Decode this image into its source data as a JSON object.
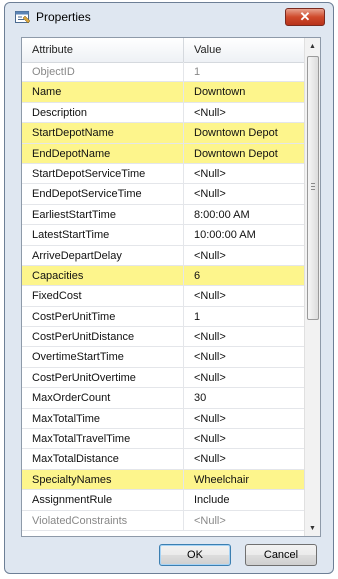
{
  "window": {
    "title": "Properties",
    "close_label": "✕"
  },
  "columns": {
    "attribute": "Attribute",
    "value": "Value"
  },
  "rows": [
    {
      "attribute": "ObjectID",
      "value": "1",
      "highlight": false,
      "grey": true
    },
    {
      "attribute": "Name",
      "value": "Downtown",
      "highlight": true,
      "grey": false
    },
    {
      "attribute": "Description",
      "value": "<Null>",
      "highlight": false,
      "grey": false
    },
    {
      "attribute": "StartDepotName",
      "value": "Downtown Depot",
      "highlight": true,
      "grey": false
    },
    {
      "attribute": "EndDepotName",
      "value": "Downtown Depot",
      "highlight": true,
      "grey": false
    },
    {
      "attribute": "StartDepotServiceTime",
      "value": "<Null>",
      "highlight": false,
      "grey": false
    },
    {
      "attribute": "EndDepotServiceTime",
      "value": "<Null>",
      "highlight": false,
      "grey": false
    },
    {
      "attribute": "EarliestStartTime",
      "value": "8:00:00 AM",
      "highlight": false,
      "grey": false
    },
    {
      "attribute": "LatestStartTime",
      "value": "10:00:00 AM",
      "highlight": false,
      "grey": false
    },
    {
      "attribute": "ArriveDepartDelay",
      "value": "<Null>",
      "highlight": false,
      "grey": false
    },
    {
      "attribute": "Capacities",
      "value": "6",
      "highlight": true,
      "grey": false
    },
    {
      "attribute": "FixedCost",
      "value": "<Null>",
      "highlight": false,
      "grey": false
    },
    {
      "attribute": "CostPerUnitTime",
      "value": "1",
      "highlight": false,
      "grey": false
    },
    {
      "attribute": "CostPerUnitDistance",
      "value": "<Null>",
      "highlight": false,
      "grey": false
    },
    {
      "attribute": "OvertimeStartTime",
      "value": "<Null>",
      "highlight": false,
      "grey": false
    },
    {
      "attribute": "CostPerUnitOvertime",
      "value": "<Null>",
      "highlight": false,
      "grey": false
    },
    {
      "attribute": "MaxOrderCount",
      "value": "30",
      "highlight": false,
      "grey": false
    },
    {
      "attribute": "MaxTotalTime",
      "value": "<Null>",
      "highlight": false,
      "grey": false
    },
    {
      "attribute": "MaxTotalTravelTime",
      "value": "<Null>",
      "highlight": false,
      "grey": false
    },
    {
      "attribute": "MaxTotalDistance",
      "value": "<Null>",
      "highlight": false,
      "grey": false
    },
    {
      "attribute": "SpecialtyNames",
      "value": "Wheelchair",
      "highlight": true,
      "grey": false
    },
    {
      "attribute": "AssignmentRule",
      "value": "Include",
      "highlight": false,
      "grey": false
    },
    {
      "attribute": "ViolatedConstraints",
      "value": "<Null>",
      "highlight": false,
      "grey": true
    }
  ],
  "buttons": {
    "ok": "OK",
    "cancel": "Cancel"
  },
  "colors": {
    "highlight": "#fdf58c",
    "dialog_bg": "#dfe7f1",
    "close_red": "#cf4a2c"
  },
  "icons": {
    "title": "properties-icon",
    "close": "close-icon"
  }
}
